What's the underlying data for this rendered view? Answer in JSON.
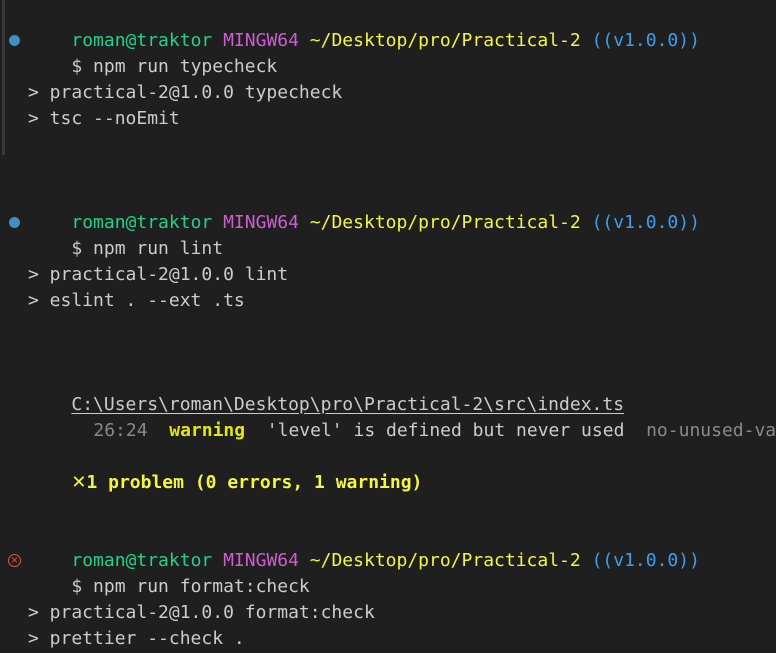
{
  "prompts": [
    {
      "user": "roman@traktor",
      "host": "MINGW64",
      "path": "~/Desktop/pro/Practical-2",
      "branch": "((v1.0.0))",
      "command": "$ npm run typecheck"
    },
    {
      "user": "roman@traktor",
      "host": "MINGW64",
      "path": "~/Desktop/pro/Practical-2",
      "branch": "((v1.0.0))",
      "command": "$ npm run lint"
    },
    {
      "user": "roman@traktor",
      "host": "MINGW64",
      "path": "~/Desktop/pro/Practical-2",
      "branch": "((v1.0.0))",
      "command": "$ npm run format:check"
    }
  ],
  "outputs": {
    "typecheck": [
      "> practical-2@1.0.0 typecheck",
      "> tsc --noEmit"
    ],
    "lint": [
      "> practical-2@1.0.0 lint",
      "> eslint . --ext .ts"
    ],
    "format": [
      "> practical-2@1.0.0 format:check",
      "> prettier --check ."
    ]
  },
  "lint_result": {
    "file": "C:\\Users\\roman\\Desktop\\pro\\Practical-2\\src\\index.ts",
    "location": "26:24",
    "severity": "warning",
    "message": "'level' is defined but never used",
    "rule": "no-unused-vars",
    "summary_icon": "✕",
    "summary": "1 problem (0 errors, 1 warning)"
  },
  "colors": {
    "user": "#23d18b",
    "host": "#cb5fd0",
    "path": "#f5f543",
    "branch": "#3b9ff0",
    "success_dot": "#3f8ec6",
    "error_dot": "#e0534c"
  },
  "icons": {
    "success": "command-success-dot-icon",
    "error": "command-error-circle-icon",
    "summary": "cross-icon"
  }
}
